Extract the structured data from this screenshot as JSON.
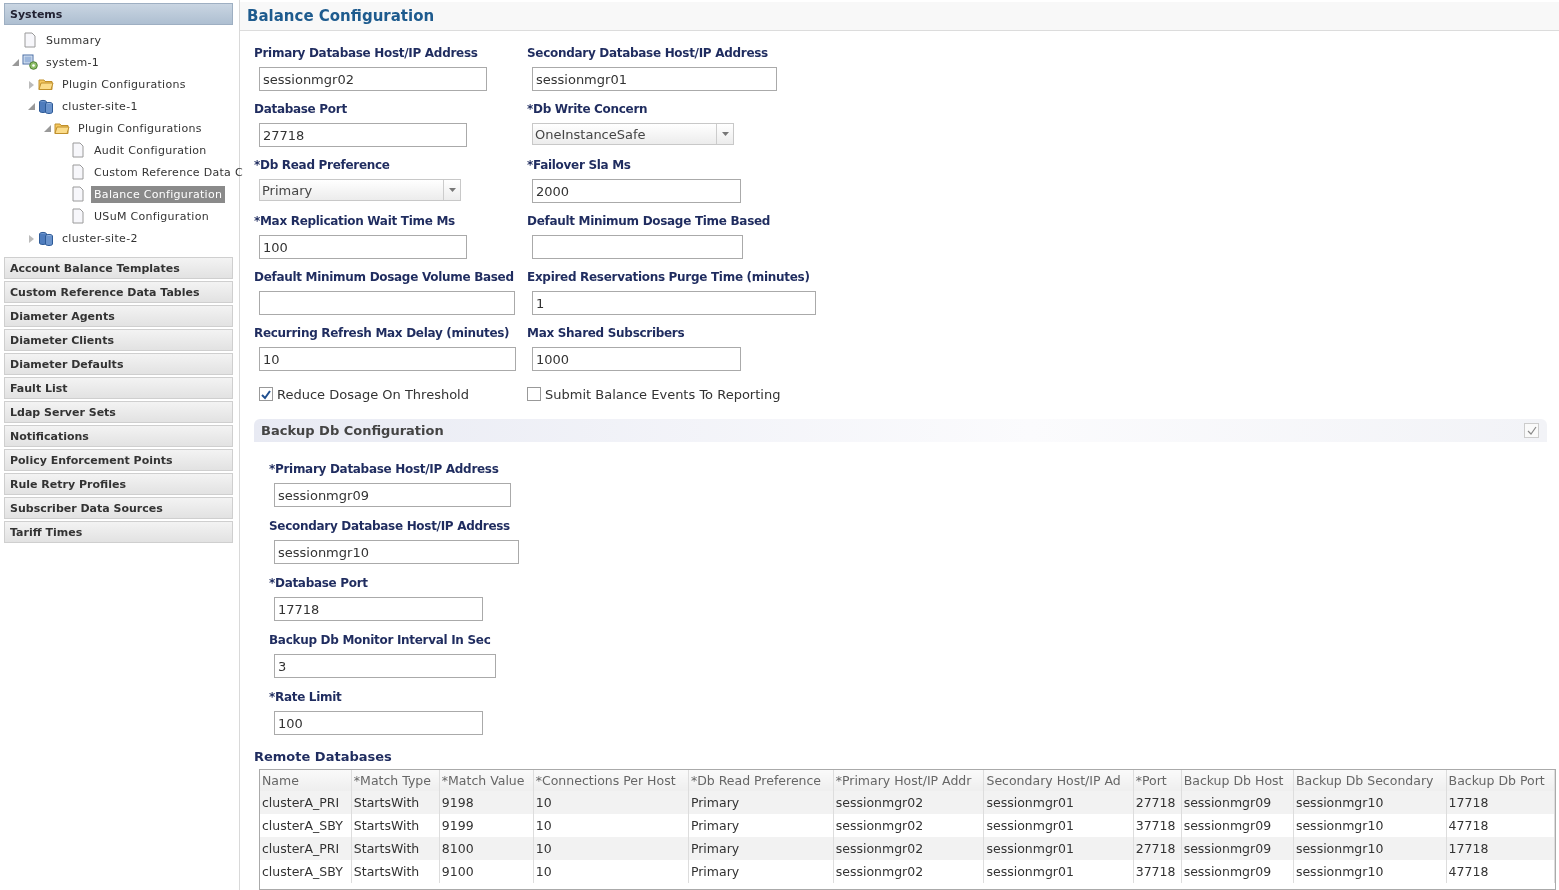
{
  "sidebar": {
    "sections": [
      {
        "title": "Systems",
        "expanded": true,
        "tree": [
          {
            "label": "Summary",
            "kind": "page",
            "selected": false
          },
          {
            "label": "system-1",
            "kind": "system",
            "expanded": true,
            "selected": false,
            "children": [
              {
                "label": "Plugin Configurations",
                "kind": "folder",
                "expanded": false,
                "selected": false
              },
              {
                "label": "cluster-site-1",
                "kind": "cluster",
                "expanded": true,
                "selected": false,
                "children": [
                  {
                    "label": "Plugin Configurations",
                    "kind": "folder",
                    "expanded": true,
                    "selected": false,
                    "children": [
                      {
                        "label": "Audit Configuration",
                        "kind": "page",
                        "selected": false
                      },
                      {
                        "label": "Custom Reference Data C",
                        "kind": "page",
                        "selected": false
                      },
                      {
                        "label": "Balance Configuration",
                        "kind": "page",
                        "selected": true
                      },
                      {
                        "label": "USuM Configuration",
                        "kind": "page",
                        "selected": false
                      }
                    ]
                  }
                ]
              },
              {
                "label": "cluster-site-2",
                "kind": "cluster",
                "expanded": false,
                "selected": false
              }
            ]
          }
        ]
      },
      {
        "title": "Account Balance Templates",
        "expanded": false
      },
      {
        "title": "Custom Reference Data Tables",
        "expanded": false
      },
      {
        "title": "Diameter Agents",
        "expanded": false
      },
      {
        "title": "Diameter Clients",
        "expanded": false
      },
      {
        "title": "Diameter Defaults",
        "expanded": false
      },
      {
        "title": "Fault List",
        "expanded": false
      },
      {
        "title": "Ldap Server Sets",
        "expanded": false
      },
      {
        "title": "Notifications",
        "expanded": false
      },
      {
        "title": "Policy Enforcement Points",
        "expanded": false
      },
      {
        "title": "Rule Retry Profiles",
        "expanded": false
      },
      {
        "title": "Subscriber Data Sources",
        "expanded": false
      },
      {
        "title": "Tariff Times",
        "expanded": false
      }
    ]
  },
  "page": {
    "title": "Balance Configuration"
  },
  "form": {
    "rows": [
      [
        {
          "label": "Primary Database Host/IP Address",
          "kind": "text",
          "value": "sessionmgr02"
        },
        {
          "label": "Secondary Database Host/IP Address",
          "kind": "text",
          "value": "sessionmgr01"
        }
      ],
      [
        {
          "label": "Database Port",
          "kind": "text",
          "value": "27718"
        },
        {
          "label": "*Db Write Concern",
          "kind": "select",
          "value": "OneInstanceSafe"
        }
      ],
      [
        {
          "label": "*Db Read Preference",
          "kind": "select",
          "value": "Primary"
        },
        {
          "label": "*Failover Sla Ms",
          "kind": "text",
          "value": "2000"
        }
      ],
      [
        {
          "label": "*Max Replication Wait Time Ms",
          "kind": "text",
          "value": "100"
        },
        {
          "label": "Default Minimum Dosage Time Based",
          "kind": "text"
        }
      ],
      [
        {
          "label": "Default Minimum Dosage Volume Based",
          "kind": "text"
        },
        {
          "label": "Expired Reservations Purge Time (minutes)",
          "kind": "text",
          "value": "1"
        }
      ],
      [
        {
          "label": "Recurring Refresh Max Delay (minutes)",
          "kind": "text",
          "value": "10"
        },
        {
          "label": "Max Shared Subscribers",
          "kind": "text",
          "value": "1000"
        }
      ]
    ],
    "checkboxes": [
      {
        "label": "Reduce Dosage On Threshold",
        "checked": true
      },
      {
        "label": "Submit Balance Events To Reporting",
        "checked": false
      }
    ]
  },
  "backup": {
    "title": "Backup Db Configuration",
    "checked": true,
    "fields": [
      {
        "label": "*Primary Database Host/IP Address",
        "value": "sessionmgr09"
      },
      {
        "label": "Secondary Database Host/IP Address",
        "value": "sessionmgr10"
      },
      {
        "label": "*Database Port",
        "value": "17718"
      },
      {
        "label": "Backup Db Monitor Interval In Sec",
        "value": "3"
      },
      {
        "label": "*Rate Limit",
        "value": "100"
      }
    ]
  },
  "remote": {
    "title": "Remote Databases",
    "columns": [
      "Name",
      "*Match Type",
      "*Match Value",
      "*Connections Per Host",
      "*Db Read Preference",
      "*Primary Host/IP Addr",
      "Secondary Host/IP Ad",
      "*Port",
      "Backup Db Host",
      "Backup Db Secondary",
      "Backup Db Port"
    ],
    "rows": [
      [
        "clusterA_PRI",
        "StartsWith",
        "9198",
        "10",
        "Primary",
        "sessionmgr02",
        "sessionmgr01",
        "27718",
        "sessionmgr09",
        "sessionmgr10",
        "17718"
      ],
      [
        "clusterA_SBY",
        "StartsWith",
        "9199",
        "10",
        "Primary",
        "sessionmgr02",
        "sessionmgr01",
        "37718",
        "sessionmgr09",
        "sessionmgr10",
        "47718"
      ],
      [
        "clusterA_PRI",
        "StartsWith",
        "8100",
        "10",
        "Primary",
        "sessionmgr02",
        "sessionmgr01",
        "27718",
        "sessionmgr09",
        "sessionmgr10",
        "17718"
      ],
      [
        "clusterA_SBY",
        "StartsWith",
        "9100",
        "10",
        "Primary",
        "sessionmgr02",
        "sessionmgr01",
        "37718",
        "sessionmgr09",
        "sessionmgr10",
        "47718"
      ]
    ]
  }
}
